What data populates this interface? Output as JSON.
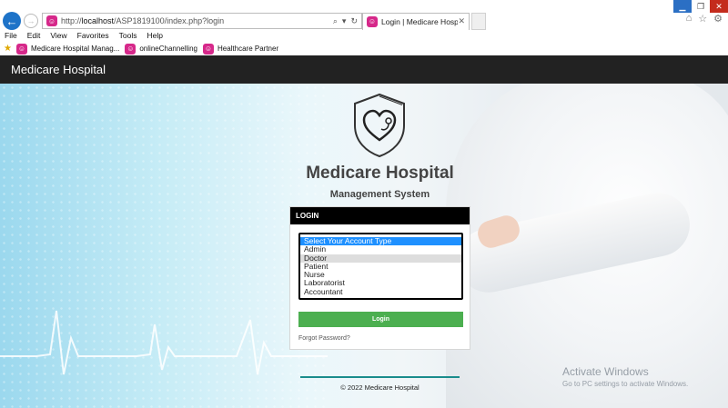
{
  "browser": {
    "url_prefix": "http://",
    "url_host": "localhost",
    "url_path": "/ASP1819100/index.php?login",
    "tab_title": "Login | Medicare Hospital",
    "menu": [
      "File",
      "Edit",
      "View",
      "Favorites",
      "Tools",
      "Help"
    ],
    "favorites": [
      "Medicare Hospital Manag...",
      "onlineChannelling",
      "Healthcare Partner"
    ]
  },
  "navbar": {
    "brand": "Medicare Hospital"
  },
  "hero": {
    "title": "Medicare Hospital",
    "subtitle": "Management System"
  },
  "login": {
    "header": "LOGIN",
    "account_options": [
      "Select Your Account Type",
      "Admin",
      "Doctor",
      "Patient",
      "Nurse",
      "Laboratorist",
      "Accountant"
    ],
    "selected_option": "Select Your Account Type",
    "button": "Login",
    "forgot": "Forgot Password?"
  },
  "footer": {
    "text": "© 2022 Medicare Hospital"
  },
  "watermark": {
    "title": "Activate Windows",
    "subtitle": "Go to PC settings to activate Windows."
  },
  "colors": {
    "navbar_bg": "#222222",
    "login_button": "#4caf50",
    "selected_option": "#1e90ff",
    "footer_line": "#1a8c8c"
  }
}
